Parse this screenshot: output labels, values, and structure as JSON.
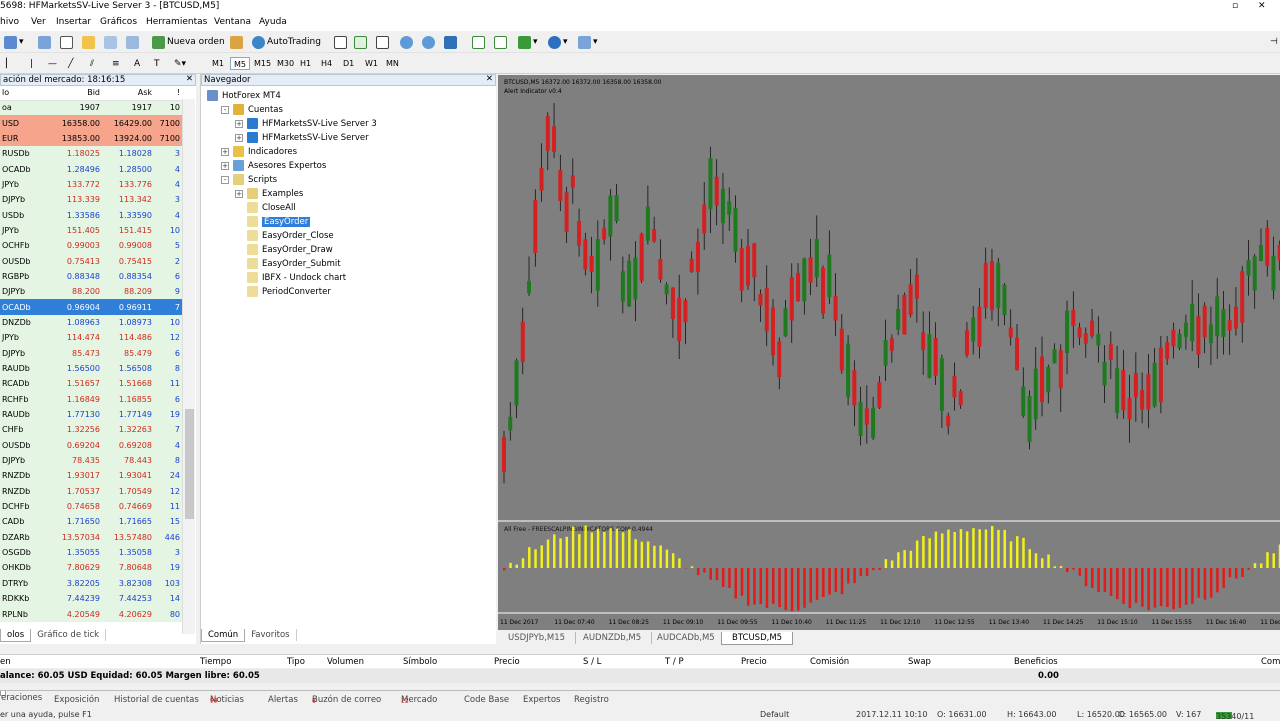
{
  "window": {
    "title": "5698: HFMarketsSV-Live Server 3 - [BTCUSD,M5]"
  },
  "menu": [
    "hivo",
    "Ver",
    "Insertar",
    "Gráficos",
    "Herramientas",
    "Ventana",
    "Ayuda"
  ],
  "toolbar": {
    "new_order": "Nueva orden",
    "autotrading": "AutoTrading"
  },
  "timeframes": [
    "M1",
    "M5",
    "M15",
    "M30",
    "H1",
    "H4",
    "D1",
    "W1",
    "MN"
  ],
  "market_watch": {
    "title": "ación del mercado: 18:16:15",
    "headers": {
      "symbol": "lo",
      "bid": "Bid",
      "ask": "Ask",
      "spread": "!"
    },
    "rows": [
      {
        "s": "oa",
        "b": "1907",
        "a": "1917",
        "p": "10",
        "st": "g"
      },
      {
        "s": "USD",
        "b": "16358.00",
        "a": "16429.00",
        "p": "7100",
        "st": "r"
      },
      {
        "s": "EUR",
        "b": "13853.00",
        "a": "13924.00",
        "p": "7100",
        "st": "r"
      },
      {
        "s": "RUSDb",
        "b": "1.18025",
        "a": "1.18028",
        "p": "3",
        "st": "rb"
      },
      {
        "s": "OCADb",
        "b": "1.28496",
        "a": "1.28500",
        "p": "4",
        "st": "bb"
      },
      {
        "s": "JPYb",
        "b": "133.772",
        "a": "133.776",
        "p": "4",
        "st": "rr"
      },
      {
        "s": "DJPYb",
        "b": "113.339",
        "a": "113.342",
        "p": "3",
        "st": "rr"
      },
      {
        "s": "USDb",
        "b": "1.33586",
        "a": "1.33590",
        "p": "4",
        "st": "bb"
      },
      {
        "s": "JPYb",
        "b": "151.405",
        "a": "151.415",
        "p": "10",
        "st": "rr"
      },
      {
        "s": "OCHFb",
        "b": "0.99003",
        "a": "0.99008",
        "p": "5",
        "st": "rr"
      },
      {
        "s": "OUSDb",
        "b": "0.75413",
        "a": "0.75415",
        "p": "2",
        "st": "rr"
      },
      {
        "s": "RGBPb",
        "b": "0.88348",
        "a": "0.88354",
        "p": "6",
        "st": "bb"
      },
      {
        "s": "DJPYb",
        "b": "88.200",
        "a": "88.209",
        "p": "9",
        "st": "rr"
      },
      {
        "s": "OCADb",
        "b": "0.96904",
        "a": "0.96911",
        "p": "7",
        "st": "sel"
      },
      {
        "s": "DNZDb",
        "b": "1.08963",
        "a": "1.08973",
        "p": "10",
        "st": "bb"
      },
      {
        "s": "JPYb",
        "b": "114.474",
        "a": "114.486",
        "p": "12",
        "st": "rr"
      },
      {
        "s": "DJPYb",
        "b": "85.473",
        "a": "85.479",
        "p": "6",
        "st": "rr"
      },
      {
        "s": "RAUDb",
        "b": "1.56500",
        "a": "1.56508",
        "p": "8",
        "st": "bb"
      },
      {
        "s": "RCADb",
        "b": "1.51657",
        "a": "1.51668",
        "p": "11",
        "st": "rr"
      },
      {
        "s": "RCHFb",
        "b": "1.16849",
        "a": "1.16855",
        "p": "6",
        "st": "rr"
      },
      {
        "s": "RAUDb",
        "b": "1.77130",
        "a": "1.77149",
        "p": "19",
        "st": "bb"
      },
      {
        "s": "CHFb",
        "b": "1.32256",
        "a": "1.32263",
        "p": "7",
        "st": "rr"
      },
      {
        "s": "OUSDb",
        "b": "0.69204",
        "a": "0.69208",
        "p": "4",
        "st": "rr"
      },
      {
        "s": "DJPYb",
        "b": "78.435",
        "a": "78.443",
        "p": "8",
        "st": "rr"
      },
      {
        "s": "RNZDb",
        "b": "1.93017",
        "a": "1.93041",
        "p": "24",
        "st": "rr"
      },
      {
        "s": "RNZDb",
        "b": "1.70537",
        "a": "1.70549",
        "p": "12",
        "st": "rr"
      },
      {
        "s": "DCHFb",
        "b": "0.74658",
        "a": "0.74669",
        "p": "11",
        "st": "rr"
      },
      {
        "s": "CADb",
        "b": "1.71650",
        "a": "1.71665",
        "p": "15",
        "st": "bb"
      },
      {
        "s": "DZARb",
        "b": "13.57034",
        "a": "13.57480",
        "p": "446",
        "st": "rr"
      },
      {
        "s": "OSGDb",
        "b": "1.35055",
        "a": "1.35058",
        "p": "3",
        "st": "bb"
      },
      {
        "s": "OHKDb",
        "b": "7.80629",
        "a": "7.80648",
        "p": "19",
        "st": "rr"
      },
      {
        "s": "DTRYb",
        "b": "3.82205",
        "a": "3.82308",
        "p": "103",
        "st": "bb"
      },
      {
        "s": "RDKKb",
        "b": "7.44239",
        "a": "7.44253",
        "p": "14",
        "st": "bb"
      },
      {
        "s": "RPLNb",
        "b": "4.20549",
        "a": "4.20629",
        "p": "80",
        "st": "rr"
      }
    ],
    "tabs": [
      "olos",
      "Gráfico de tick"
    ]
  },
  "navigator": {
    "title": "Navegador",
    "items": [
      {
        "label": "HotForex MT4",
        "level": 0,
        "pm": "",
        "icon": "#6b8fc9"
      },
      {
        "label": "Cuentas",
        "level": 1,
        "pm": "-",
        "icon": "#e0b23a"
      },
      {
        "label": "HFMarketsSV-Live Server 3",
        "level": 2,
        "pm": "+",
        "icon": "#2a7ad0"
      },
      {
        "label": "HFMarketsSV-Live Server",
        "level": 2,
        "pm": "+",
        "icon": "#2a7ad0"
      },
      {
        "label": "Indicadores",
        "level": 1,
        "pm": "+",
        "icon": "#e8c14a"
      },
      {
        "label": "Asesores Expertos",
        "level": 1,
        "pm": "+",
        "icon": "#6aa0d8"
      },
      {
        "label": "Scripts",
        "level": 1,
        "pm": "-",
        "icon": "#e6cf7a"
      },
      {
        "label": "Examples",
        "level": 2,
        "pm": "+",
        "icon": "#e6cf7a"
      },
      {
        "label": "CloseAll",
        "level": 2,
        "pm": "",
        "icon": "#eedd99"
      },
      {
        "label": "EasyOrder",
        "level": 2,
        "pm": "",
        "icon": "#eedd99",
        "sel": true
      },
      {
        "label": "EasyOrder_Close",
        "level": 2,
        "pm": "",
        "icon": "#eedd99"
      },
      {
        "label": "EasyOrder_Draw",
        "level": 2,
        "pm": "",
        "icon": "#eedd99"
      },
      {
        "label": "EasyOrder_Submit",
        "level": 2,
        "pm": "",
        "icon": "#eedd99"
      },
      {
        "label": "IBFX - Undock chart",
        "level": 2,
        "pm": "",
        "icon": "#eedd99"
      },
      {
        "label": "PeriodConverter",
        "level": 2,
        "pm": "",
        "icon": "#eedd99"
      }
    ],
    "tabs": [
      "Común",
      "Favoritos"
    ]
  },
  "chart": {
    "header": "BTCUSD,M5  16372.00 16372.00 16358.00 16358.00",
    "indicator": "Alert Indicator v0.4",
    "sub_label": "All Free - FREESCALPINGINDICATORS.COM 0.4944",
    "time_labels": [
      "11 Dec 2017",
      "11 Dec 07:40",
      "11 Dec 08:25",
      "11 Dec 09:10",
      "11 Dec 09:55",
      "11 Dec 10:40",
      "11 Dec 11:25",
      "11 Dec 12:10",
      "11 Dec 12:55",
      "11 Dec 13:40",
      "11 Dec 14:25",
      "11 Dec 15:10",
      "11 Dec 15:55",
      "11 Dec 16:40",
      "11 Dec 17:25"
    ],
    "colors": {
      "bg": "#7f7f7f",
      "bull": "#1f7a1f",
      "bear": "#d42020",
      "hist_up": "#f2f21a",
      "hist_down": "#e11a1a",
      "grid_line": "#ffffff"
    },
    "tabs": [
      "USDJPYb,M15",
      "AUDNZDb,M5",
      "AUDCADb,M5",
      "BTCUSD,M5"
    ]
  },
  "terminal": {
    "headers": [
      "en",
      "Tiempo",
      "Tipo",
      "Volumen",
      "Símbolo",
      "Precio",
      "S / L",
      "T / P",
      "Precio",
      "Comisión",
      "Swap",
      "Beneficios",
      "Com"
    ],
    "balance": "alance: 60.05 USD  Equidad: 60.05  Margen libre: 60.05",
    "profit": "0.00",
    "tabs": [
      {
        "label": "eraciones",
        "badge": ""
      },
      {
        "label": "Exposición",
        "badge": ""
      },
      {
        "label": "Historial de cuentas",
        "badge": ""
      },
      {
        "label": "Noticias",
        "badge": "99"
      },
      {
        "label": "Alertas",
        "badge": ""
      },
      {
        "label": "Buzón de correo",
        "badge": "8"
      },
      {
        "label": "Mercado",
        "badge": "22"
      },
      {
        "label": "Code Base",
        "badge": ""
      },
      {
        "label": "Expertos",
        "badge": ""
      },
      {
        "label": "Registro",
        "badge": ""
      }
    ]
  },
  "status": {
    "help": "er una ayuda, pulse F1",
    "profile": "Default",
    "datetime": "2017.12.11 10:10",
    "open": "O: 16631.00",
    "high": "H: 16643.00",
    "low": "L: 16520.00",
    "close": "C: 16565.00",
    "volume": "V: 167",
    "traffic": "35340/11"
  }
}
